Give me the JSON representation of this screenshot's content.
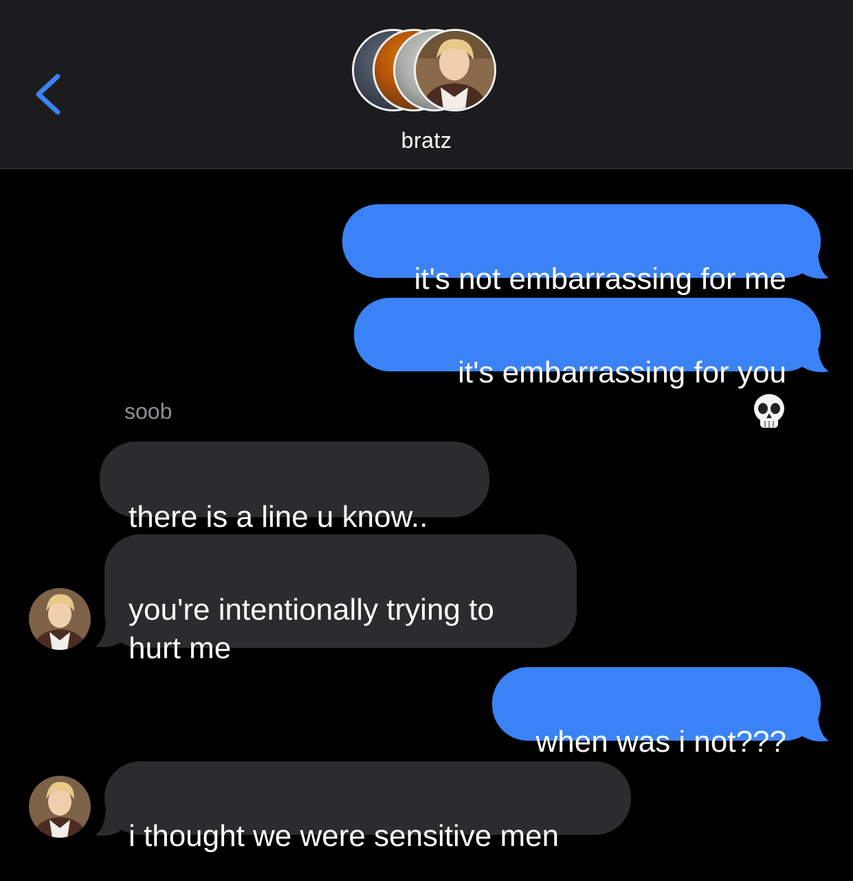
{
  "header": {
    "group_name": "bratz",
    "back_icon": "chevron-left-icon",
    "accent_color": "#3b82f6"
  },
  "messages": [
    {
      "direction": "outgoing",
      "text": "it's not embarrassing for me"
    },
    {
      "direction": "outgoing",
      "text": "it's embarrassing for you",
      "emoji": "💀"
    },
    {
      "direction": "incoming",
      "sender": "soob",
      "text": "there is a line u know.."
    },
    {
      "direction": "incoming",
      "text": "you're intentionally trying to\nhurt me"
    },
    {
      "direction": "outgoing",
      "text": "when was i not???"
    },
    {
      "direction": "incoming",
      "text": "i thought we were sensitive men"
    }
  ],
  "colors": {
    "outgoing_bubble": "#3b82f6",
    "incoming_bubble": "#2c2c2e",
    "header_bg": "#1c1c1e",
    "background": "#000000",
    "sender_label": "#8e8e93"
  }
}
